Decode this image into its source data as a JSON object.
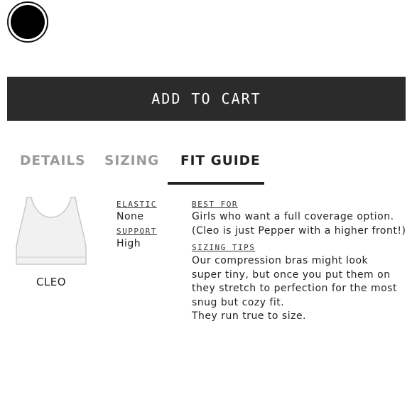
{
  "swatch": {
    "color": "#000000"
  },
  "actions": {
    "add_to_cart": "ADD TO CART"
  },
  "tabs": [
    {
      "label": "DETAILS",
      "active": false
    },
    {
      "label": "SIZING",
      "active": false
    },
    {
      "label": "FIT GUIDE",
      "active": true
    }
  ],
  "product": {
    "name": "CLEO",
    "image_icon": "sports-bra-icon"
  },
  "specs": {
    "elastic_label": "ELASTIC",
    "elastic_value": "None",
    "support_label": "SUPPORT",
    "support_value": "High"
  },
  "fit": {
    "best_for_label": "BEST FOR",
    "best_for_lines": [
      "Girls who want a full coverage option.",
      "(Cleo is just Pepper with a higher front!)"
    ],
    "sizing_tips_label": "SIZING TIPS",
    "sizing_tips_lines": [
      "Our compression bras might look",
      "super tiny, but once you put them on",
      "they stretch to perfection for the most",
      "snug but cozy fit.",
      "They run true to size."
    ]
  }
}
